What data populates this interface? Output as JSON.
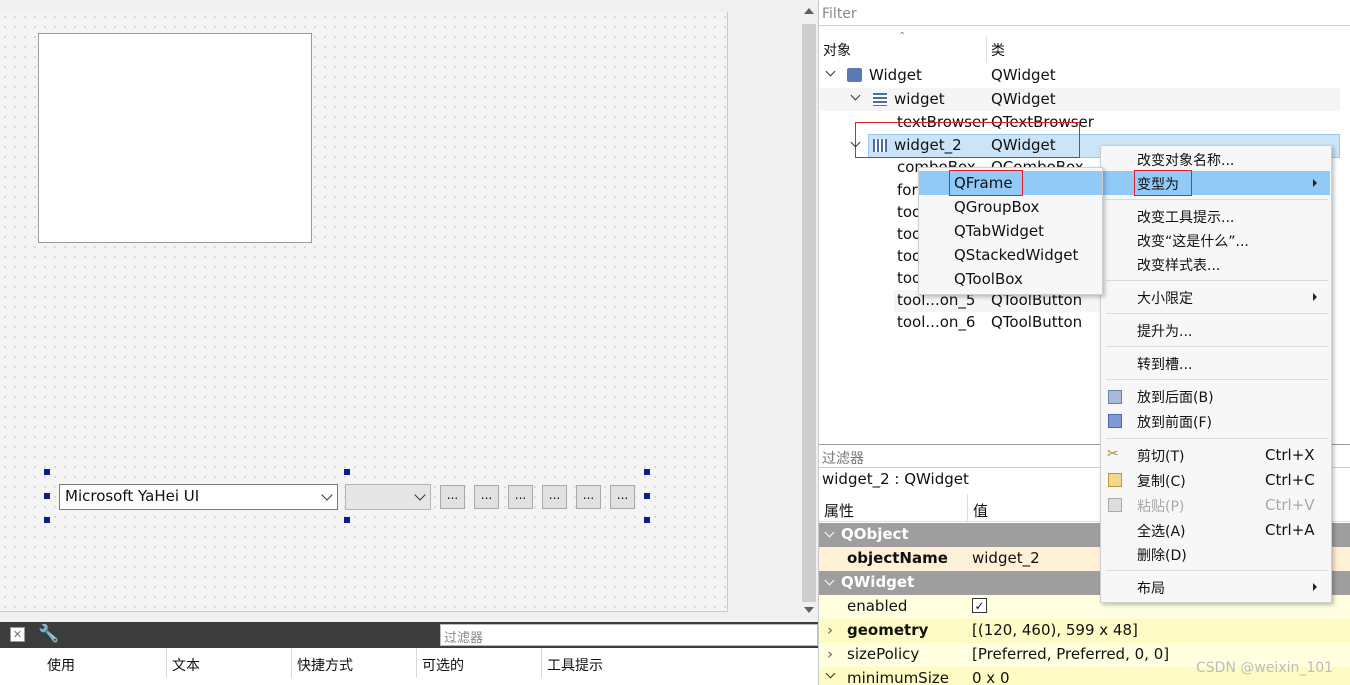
{
  "canvas": {
    "combo_font_value": "Microsoft YaHei UI",
    "tool_button_label": "...",
    "tool_button_count": 6
  },
  "bottom": {
    "filter_placeholder": "过滤器",
    "columns": [
      "使用",
      "文本",
      "快捷方式",
      "可选的",
      "工具提示"
    ]
  },
  "object_inspector": {
    "filter_placeholder": "Filter",
    "col_object": "对象",
    "col_class": "类",
    "rows": [
      {
        "name": "Widget",
        "class": "QWidget"
      },
      {
        "name": "widget",
        "class": "QWidget"
      },
      {
        "name": "textBrowser",
        "class": "QTextBrowser"
      },
      {
        "name": "widget_2",
        "class": "QWidget"
      },
      {
        "name": "comboBox",
        "class": "QComboBox"
      },
      {
        "name": "for",
        "class": ""
      },
      {
        "name": "too",
        "class": ""
      },
      {
        "name": "too",
        "class": ""
      },
      {
        "name": "too",
        "class": ""
      },
      {
        "name": "too",
        "class": ""
      },
      {
        "name": "tool...on_5",
        "class": "QToolButton"
      },
      {
        "name": "tool...on_6",
        "class": "QToolButton"
      }
    ]
  },
  "property_editor": {
    "filter_placeholder": "过滤器",
    "title": "widget_2 : QWidget",
    "col_prop": "属性",
    "col_value": "值",
    "groups": {
      "qobject": "QObject",
      "qwidget": "QWidget"
    },
    "rows": [
      {
        "name": "objectName",
        "value": "widget_2"
      },
      {
        "name": "enabled",
        "value": "✓"
      },
      {
        "name": "geometry",
        "value": "[(120, 460), 599 x 48]"
      },
      {
        "name": "sizePolicy",
        "value": "[Preferred, Preferred, 0, 0]"
      },
      {
        "name": "minimumSize",
        "value": "0 x 0"
      }
    ]
  },
  "context_menu": {
    "items": {
      "rename": "改变对象名称...",
      "morph": "变型为",
      "tooltip": "改变工具提示...",
      "whatsthis": "改变“这是什么”...",
      "stylesheet": "改变样式表...",
      "size_constraints": "大小限定",
      "promote": "提升为...",
      "goto_slot": "转到槽...",
      "send_back": "放到后面(B)",
      "bring_front": "放到前面(F)",
      "cut": "剪切(T)",
      "copy": "复制(C)",
      "paste": "粘贴(P)",
      "select_all": "全选(A)",
      "delete": "删除(D)",
      "layout": "布局"
    },
    "shortcuts": {
      "cut": "Ctrl+X",
      "copy": "Ctrl+C",
      "paste": "Ctrl+V",
      "select_all": "Ctrl+A"
    }
  },
  "morph_submenu": [
    "QFrame",
    "QGroupBox",
    "QTabWidget",
    "QStackedWidget",
    "QToolBox"
  ],
  "watermark": "CSDN @weixin_101",
  "colors": {
    "selection": "#cce4f7",
    "highlight": "#91c9f7",
    "annotation": "#e0202a",
    "group_header": "#9e9e9e"
  }
}
